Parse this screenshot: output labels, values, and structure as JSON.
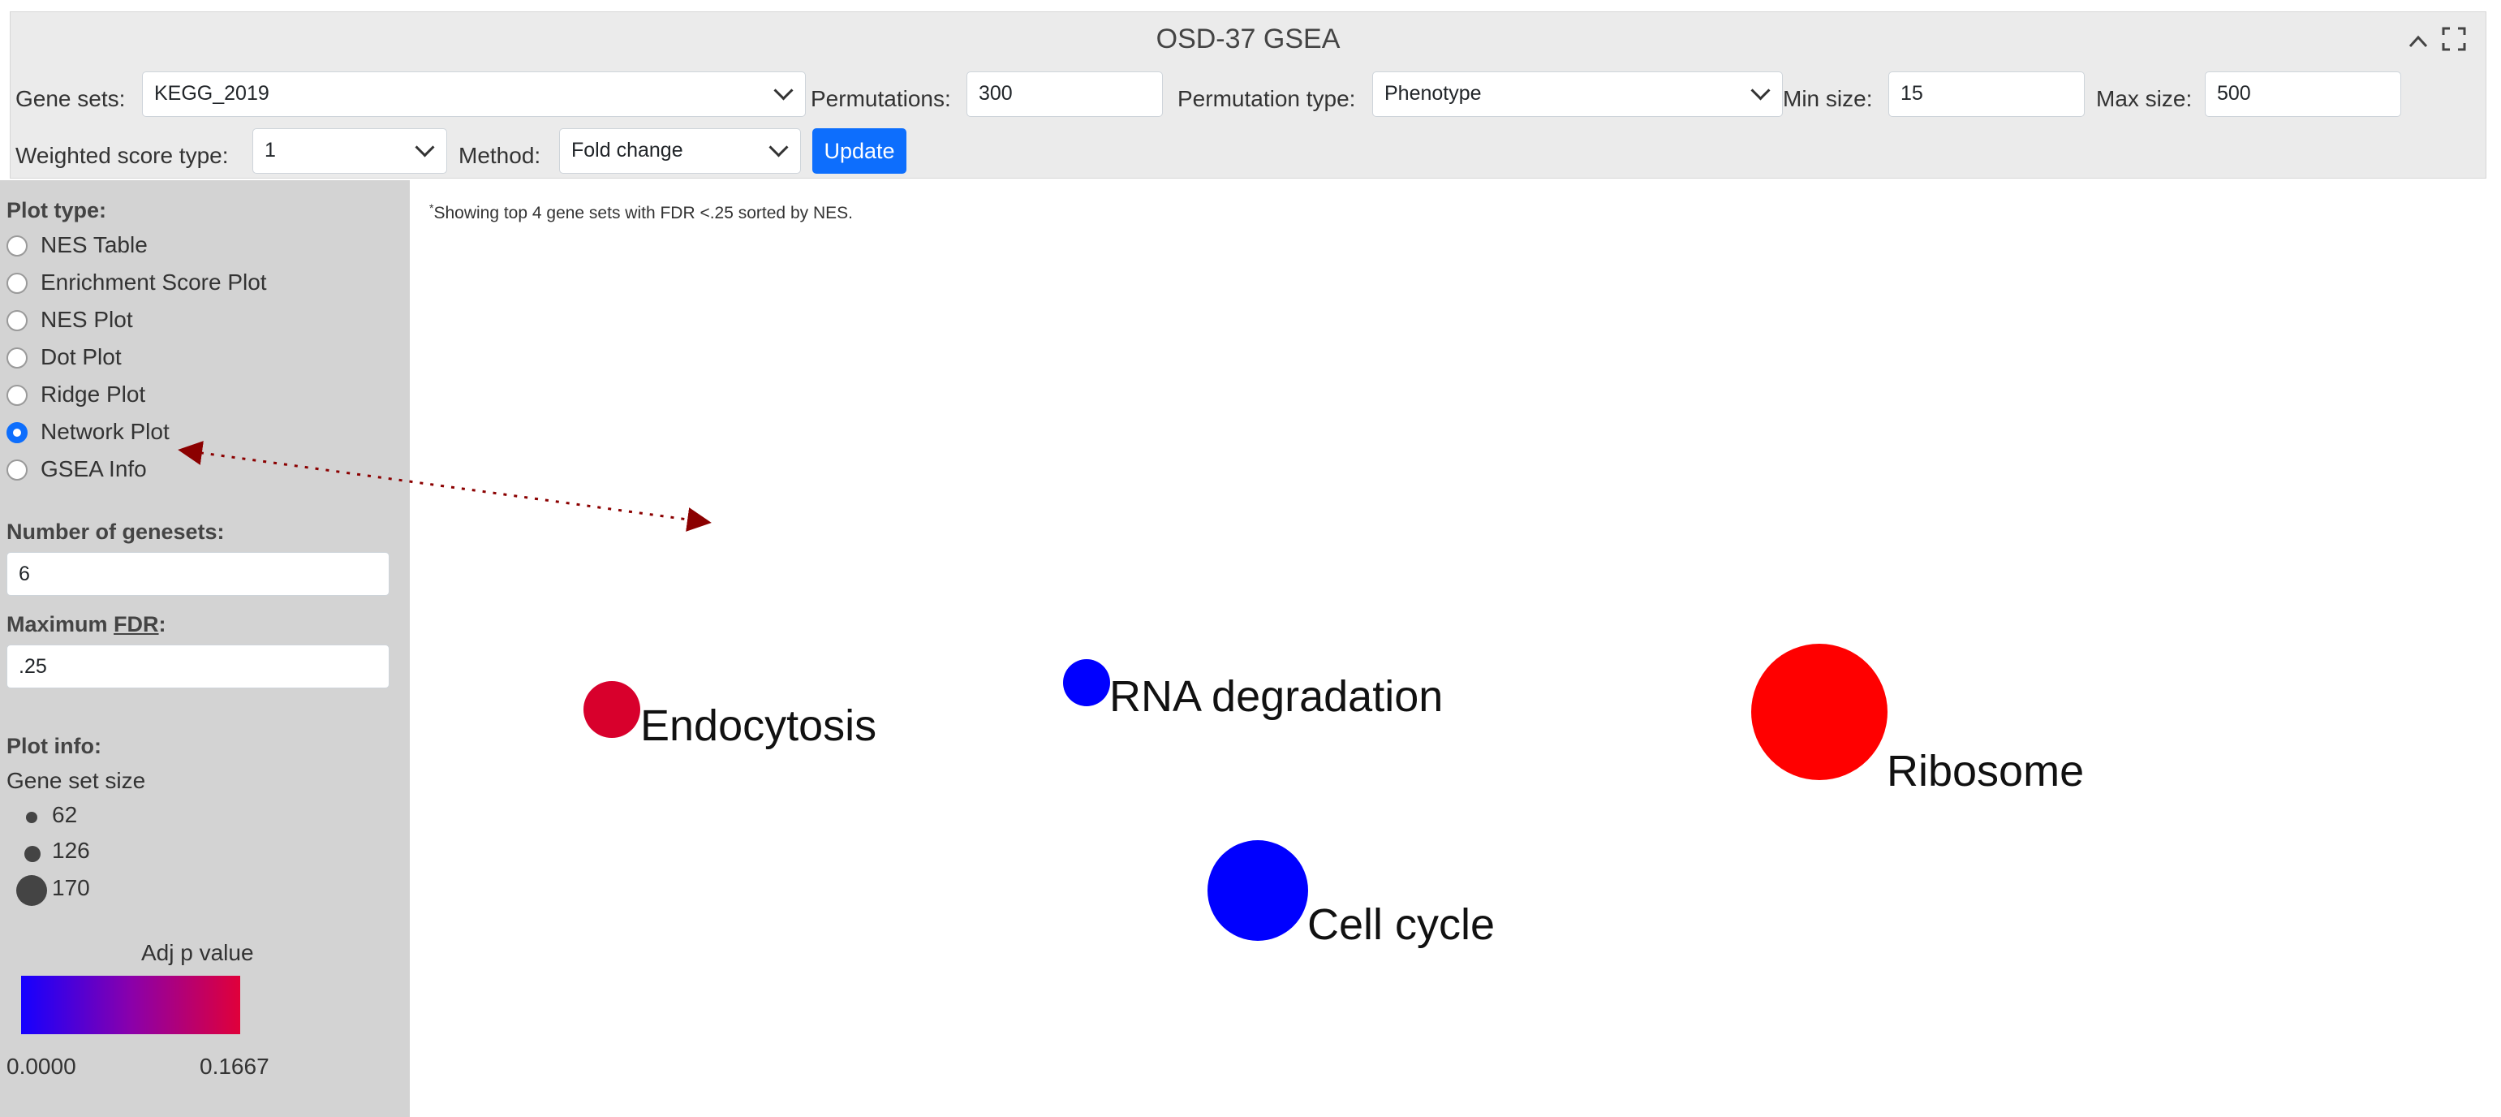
{
  "header": {
    "title": "OSD-37 GSEA",
    "collapse_icon": "chevron-up-icon",
    "expand_icon": "fullscreen-icon"
  },
  "toolbar": {
    "gene_sets_label": "Gene sets:",
    "gene_sets_value": "KEGG_2019",
    "permutations_label": "Permutations:",
    "permutations_value": "300",
    "permutation_type_label": "Permutation type:",
    "permutation_type_value": "Phenotype",
    "min_size_label": "Min size:",
    "min_size_value": "15",
    "max_size_label": "Max size:",
    "max_size_value": "500",
    "weighted_label": "Weighted score type:",
    "weighted_value": "1",
    "method_label": "Method:",
    "method_value": "Fold change",
    "update_label": "Update"
  },
  "sidebar": {
    "plot_type_label": "Plot type:",
    "plot_types": [
      {
        "label": "NES Table",
        "checked": false
      },
      {
        "label": "Enrichment Score Plot",
        "checked": false
      },
      {
        "label": "NES Plot",
        "checked": false
      },
      {
        "label": "Dot Plot",
        "checked": false
      },
      {
        "label": "Ridge Plot",
        "checked": false
      },
      {
        "label": "Network Plot",
        "checked": true
      },
      {
        "label": "GSEA Info",
        "checked": false
      }
    ],
    "num_genesets_label": "Number of genesets:",
    "num_genesets_value": "6",
    "max_fdr_prefix": "Maximum ",
    "max_fdr_abbr": "FDR",
    "max_fdr_suffix": ":",
    "max_fdr_value": ".25",
    "plot_info_label": "Plot info:",
    "gene_set_size_label": "Gene set size",
    "size_legend": [
      "62",
      "126",
      "170"
    ],
    "adj_p_label": "Adj p value",
    "gradient_min": "0.0000",
    "gradient_max": "0.1667",
    "gradient_colors": [
      "#1500ff",
      "#8a00ab",
      "#e0003a"
    ]
  },
  "main": {
    "note_star": "*",
    "note_text": "Showing top 4 gene sets with FDR <.25 sorted by NES."
  },
  "network": {
    "nodes": [
      {
        "label": "Endocytosis",
        "color": "#d8002c",
        "size": "small"
      },
      {
        "label": "RNA degradation",
        "color": "#0000ff",
        "size": "small"
      },
      {
        "label": "Ribosome",
        "color": "#ff0000",
        "size": "large"
      },
      {
        "label": "Cell cycle",
        "color": "#0000ff",
        "size": "medium"
      }
    ],
    "annotation_arrow_color": "#8b0000"
  }
}
